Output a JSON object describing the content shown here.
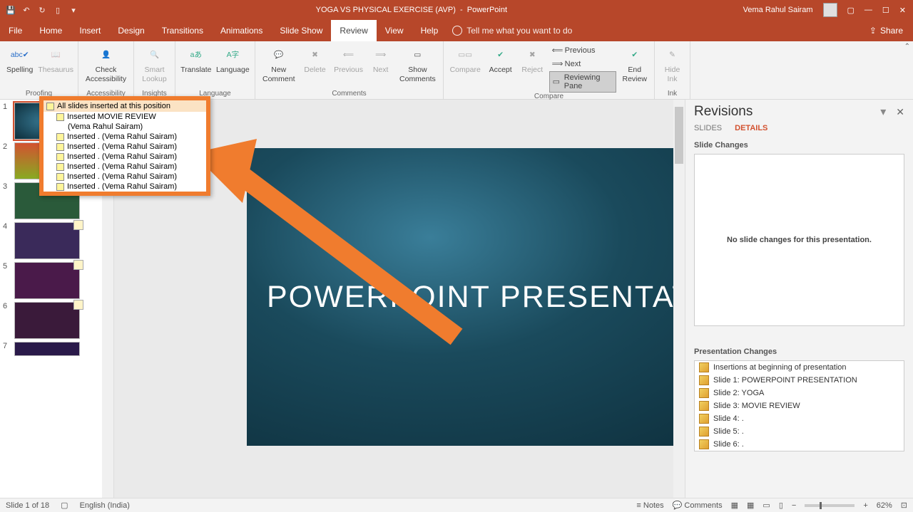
{
  "titlebar": {
    "doc_title": "YOGA VS PHYSICAL EXERCISE (AVP)",
    "app_name": "PowerPoint",
    "user": "Vema Rahul Sairam"
  },
  "menu": {
    "tabs": [
      "File",
      "Home",
      "Insert",
      "Design",
      "Transitions",
      "Animations",
      "Slide Show",
      "Review",
      "View",
      "Help"
    ],
    "active": "Review",
    "tell_me": "Tell me what you want to do",
    "share": "Share"
  },
  "ribbon": {
    "groups": {
      "proofing": {
        "label": "Proofing",
        "spelling": "Spelling",
        "thesaurus": "Thesaurus"
      },
      "accessibility": {
        "label": "Accessibility",
        "check": "Check Accessibility"
      },
      "insights": {
        "label": "Insights",
        "smart": "Smart Lookup"
      },
      "language": {
        "label": "Language",
        "translate": "Translate",
        "language": "Language"
      },
      "comments": {
        "label": "Comments",
        "new": "New Comment",
        "delete": "Delete",
        "previous": "Previous",
        "next": "Next",
        "show": "Show Comments"
      },
      "compare": {
        "label": "Compare",
        "compare": "Compare",
        "accept": "Accept",
        "reject": "Reject",
        "prev": "Previous",
        "nxt": "Next",
        "reviewing": "Reviewing Pane",
        "end": "End Review"
      },
      "ink": {
        "label": "Ink",
        "hide": "Hide Ink"
      }
    }
  },
  "slide": {
    "title": "POWERPOINT PRESENTATION"
  },
  "thumbs": {
    "count": 7
  },
  "popup": {
    "header": "All slides inserted at this position",
    "rows": [
      "Inserted          MOVIE REVIEW",
      "(Vema Rahul Sairam)",
      "Inserted . (Vema Rahul Sairam)",
      "Inserted . (Vema Rahul Sairam)",
      "Inserted . (Vema Rahul Sairam)",
      "Inserted . (Vema Rahul Sairam)",
      "Inserted . (Vema Rahul Sairam)",
      "Inserted . (Vema Rahul Sairam)"
    ]
  },
  "revisions": {
    "title": "Revisions",
    "tabs": {
      "slides": "SLIDES",
      "details": "DETAILS"
    },
    "slide_changes_label": "Slide Changes",
    "no_changes": "No slide changes for this presentation.",
    "pres_changes_label": "Presentation Changes",
    "changes": [
      "Insertions at beginning of presentation",
      "Slide 1: POWERPOINT PRESENTATION",
      "Slide 2: YOGA",
      "Slide 3:           MOVIE REVIEW",
      "Slide 4: .",
      "Slide 5: .",
      "Slide 6: ."
    ]
  },
  "status": {
    "slide": "Slide 1 of 18",
    "lang": "English (India)",
    "notes": "Notes",
    "comments": "Comments",
    "zoom": "62%"
  }
}
